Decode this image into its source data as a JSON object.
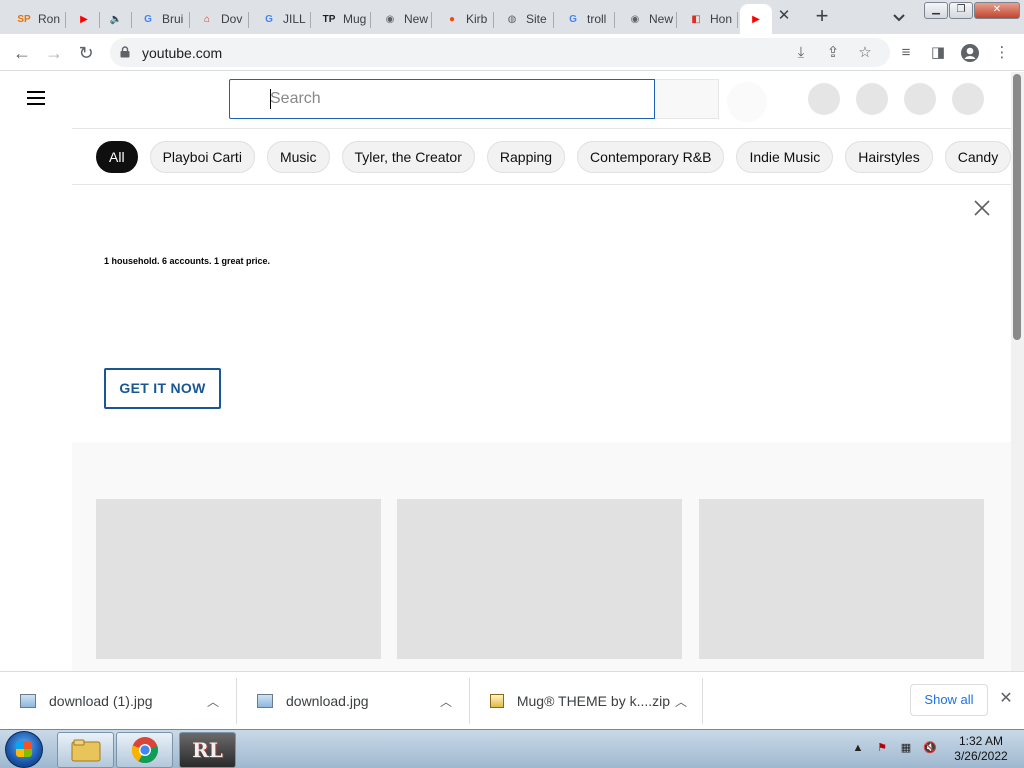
{
  "browser": {
    "tabs": [
      {
        "title": "Ron",
        "favicon": "sp-icon",
        "color": "#e8710a",
        "glyph": "SP"
      },
      {
        "title": "",
        "favicon": "youtube-icon",
        "color": "#ff0000",
        "glyph": "▶"
      },
      {
        "title": "",
        "favicon": "speaker-icon",
        "color": "#3c4043",
        "glyph": "🔈"
      },
      {
        "title": "Brui",
        "favicon": "google-icon",
        "color": "#4285f4",
        "glyph": "G"
      },
      {
        "title": "Dov",
        "favicon": "store-icon",
        "color": "#d93025",
        "glyph": "⌂"
      },
      {
        "title": "JILL",
        "favicon": "google-icon",
        "color": "#4285f4",
        "glyph": "G"
      },
      {
        "title": "Mug",
        "favicon": "tp-icon",
        "color": "#202124",
        "glyph": "TP"
      },
      {
        "title": "New",
        "favicon": "chrome-icon",
        "color": "#5f6368",
        "glyph": "◉"
      },
      {
        "title": "Kirb",
        "favicon": "reddit-icon",
        "color": "#ff4500",
        "glyph": "●"
      },
      {
        "title": "Site",
        "favicon": "globe-icon",
        "color": "#5f6368",
        "glyph": "◍"
      },
      {
        "title": "troll",
        "favicon": "google-icon",
        "color": "#4285f4",
        "glyph": "G"
      },
      {
        "title": "New",
        "favicon": "chrome-icon",
        "color": "#5f6368",
        "glyph": "◉"
      },
      {
        "title": "Hon",
        "favicon": "app-icon",
        "color": "#d93025",
        "glyph": "◧"
      },
      {
        "title": "",
        "favicon": "youtube-icon",
        "color": "#ff0000",
        "glyph": "▶",
        "active": true
      }
    ],
    "url": "youtube.com"
  },
  "youtube": {
    "search_placeholder": "Search",
    "chips": [
      "All",
      "Playboi Carti",
      "Music",
      "Tyler, the Creator",
      "Rapping",
      "Contemporary R&B",
      "Indie Music",
      "Hairstyles",
      "Candy"
    ],
    "promo": {
      "tagline": "1 household. 6 accounts. 1 great price.",
      "cta": "GET IT NOW"
    }
  },
  "downloads": {
    "items": [
      {
        "name": "download (1).jpg",
        "type": "image"
      },
      {
        "name": "download.jpg",
        "type": "image"
      },
      {
        "name": "Mug® THEME by k....zip",
        "type": "zip"
      }
    ],
    "show_all": "Show all"
  },
  "taskbar": {
    "time": "1:32 AM",
    "date": "3/26/2022"
  }
}
